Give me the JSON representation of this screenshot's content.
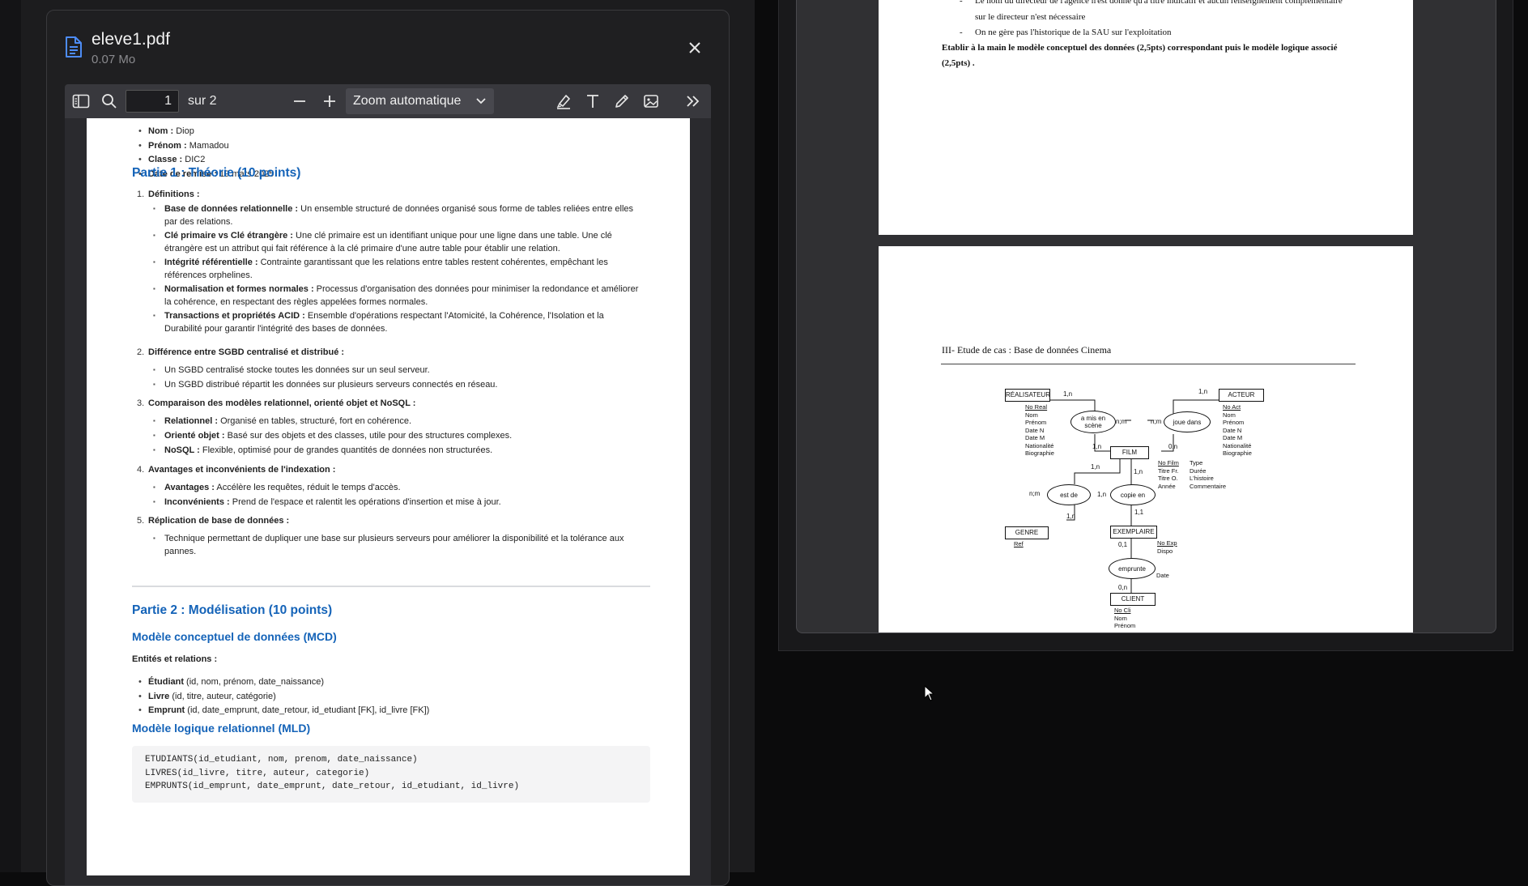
{
  "modal": {
    "file_name": "eleve1.pdf",
    "file_size": "0.07 Mo",
    "toolbar": {
      "page_value": "1",
      "page_total": "sur 2",
      "zoom": "Zoom automatique"
    }
  },
  "doc": {
    "info": [
      {
        "label": "Nom :",
        "value": " Diop"
      },
      {
        "label": "Prénom :",
        "value": " Mamadou"
      },
      {
        "label": "Classe :",
        "value": " DIC2"
      },
      {
        "label": "Date de remise :",
        "value": " 19 mars 2025"
      }
    ],
    "part1_title": "Partie 1 : Théorie (10 points)",
    "sections": [
      {
        "num": "1.",
        "title": "Définitions :"
      },
      {
        "num": "2.",
        "title": "Différence entre SGBD centralisé et distribué :"
      },
      {
        "num": "3.",
        "title": "Comparaison des modèles relationnel, orienté objet et NoSQL :"
      },
      {
        "num": "4.",
        "title": "Avantages et inconvénients de l'indexation :"
      },
      {
        "num": "5.",
        "title": "Réplication de base de données :"
      }
    ],
    "defs": [
      {
        "label": "Base de données relationnelle :",
        "text": " Un ensemble structuré de données organisé sous forme de tables reliées entre elles",
        "cont": "par des relations."
      },
      {
        "label": "Clé primaire vs Clé étrangère :",
        "text": " Une clé primaire est un identifiant unique pour une ligne dans une table. Une clé",
        "cont": "étrangère est un attribut qui fait référence à la clé primaire d'une autre table pour établir une relation."
      },
      {
        "label": "Intégrité référentielle :",
        "text": " Contrainte garantissant que les relations entre tables restent cohérentes, empêchant les",
        "cont": "références orphelines."
      },
      {
        "label": "Normalisation et formes normales :",
        "text": " Processus d'organisation des données pour minimiser la redondance et améliorer",
        "cont": "la cohérence, en respectant des règles appelées formes normales."
      },
      {
        "label": "Transactions et propriétés ACID :",
        "text": " Ensemble d'opérations respectant l'Atomicité, la Cohérence, l'Isolation et la",
        "cont": "Durabilité pour garantir l'intégrité des bases de données."
      }
    ],
    "sgbd": [
      "Un SGBD centralisé stocke toutes les données sur un seul serveur.",
      "Un SGBD distribué répartit les données sur plusieurs serveurs connectés en réseau."
    ],
    "models": [
      {
        "label": "Relationnel :",
        "text": " Organisé en tables, structuré, fort en cohérence."
      },
      {
        "label": "Orienté objet :",
        "text": " Basé sur des objets et des classes, utile pour des structures complexes."
      },
      {
        "label": "NoSQL :",
        "text": " Flexible, optimisé pour de grandes quantités de données non structurées."
      }
    ],
    "index": [
      {
        "label": "Avantages :",
        "text": " Accélère les requêtes, réduit le temps d'accès."
      },
      {
        "label": "Inconvénients :",
        "text": " Prend de l'espace et ralentit les opérations d'insertion et mise à jour."
      }
    ],
    "replication": {
      "text": "Technique permettant de dupliquer une base sur plusieurs serveurs pour améliorer la disponibilité et la tolérance aux",
      "cont": "pannes."
    },
    "part2_title": "Partie 2 : Modélisation (10 points)",
    "mcd_title": "Modèle conceptuel de données (MCD)",
    "entities_title": "Entités et relations :",
    "entities": [
      {
        "label": "Étudiant",
        "text": " (id, nom, prénom, date_naissance)"
      },
      {
        "label": "Livre",
        "text": " (id, titre, auteur, catégorie)"
      },
      {
        "label": "Emprunt",
        "text": " (id, date_emprunt, date_retour, id_etudiant [FK], id_livre [FK])"
      }
    ],
    "mld_title": "Modèle logique relationnel (MLD)",
    "code": [
      "ETUDIANTS(id_etudiant, nom, prenom, date_naissance)",
      "LIVRES(id_livre, titre, auteur, categorie)",
      "EMPRUNTS(id_emprunt, date_emprunt, date_retour, id_etudiant, id_livre)"
    ]
  },
  "right": {
    "page1_lines": [
      {
        "prefix": "-",
        "text": "Le nom du directeur de l'agence n'est donné qu'à titre indicatif et aucun renseignement complémentaire"
      },
      {
        "prefix": "",
        "text": "sur le directeur n'est nécessaire"
      },
      {
        "prefix": "-",
        "text": "On ne gère pas l'historique de la SAU sur l'exploitation"
      }
    ],
    "page1_bold_1": "Etablir à la main le modèle conceptuel des données  (2,5pts) correspondant puis le modèle logique associé",
    "page1_bold_2": "(2,5pts) .",
    "page2_title": "III- Etude de cas : Base de données Cinema",
    "er": {
      "realisateur": "RÉALISATEUR",
      "realisateur_attrs": [
        "No Real",
        "Nom",
        "Prénom",
        "Date N",
        "Date M",
        "Nationalité",
        "Biographie"
      ],
      "acteur": "ACTEUR",
      "acteur_attrs": [
        "No Act",
        "Nom",
        "Prénom",
        "Date N",
        "Date M",
        "Nationalité",
        "Biographie"
      ],
      "film": "FILM",
      "film_attrs_1": [
        "No Film",
        "Titre Fr.",
        "Titre O.",
        "Année"
      ],
      "film_attrs_2": [
        "Type",
        "Durée",
        "L'histoire",
        "Commentaire"
      ],
      "mis_en_scene_1": "a mis en",
      "mis_en_scene_2": "scène",
      "joue_dans": "joue dans",
      "est_de": "est de",
      "copie_en": "copie en",
      "genre": "GENRE",
      "genre_attrs": [
        "Ref"
      ],
      "exemplaire": "EXEMPLAIRE",
      "exemplaire_attrs": [
        "No Exp",
        "Dispo"
      ],
      "emprunte": "emprunte",
      "emprunte_attrs": [
        "Date"
      ],
      "client": "CLIENT",
      "client_attrs": [
        "No Cli",
        "Nom",
        "Prénom"
      ],
      "card_1n": "1,n",
      "card_0n": "0,n",
      "card_nm": "n;m",
      "card_11": "1,1",
      "card_01": "0,1"
    }
  }
}
